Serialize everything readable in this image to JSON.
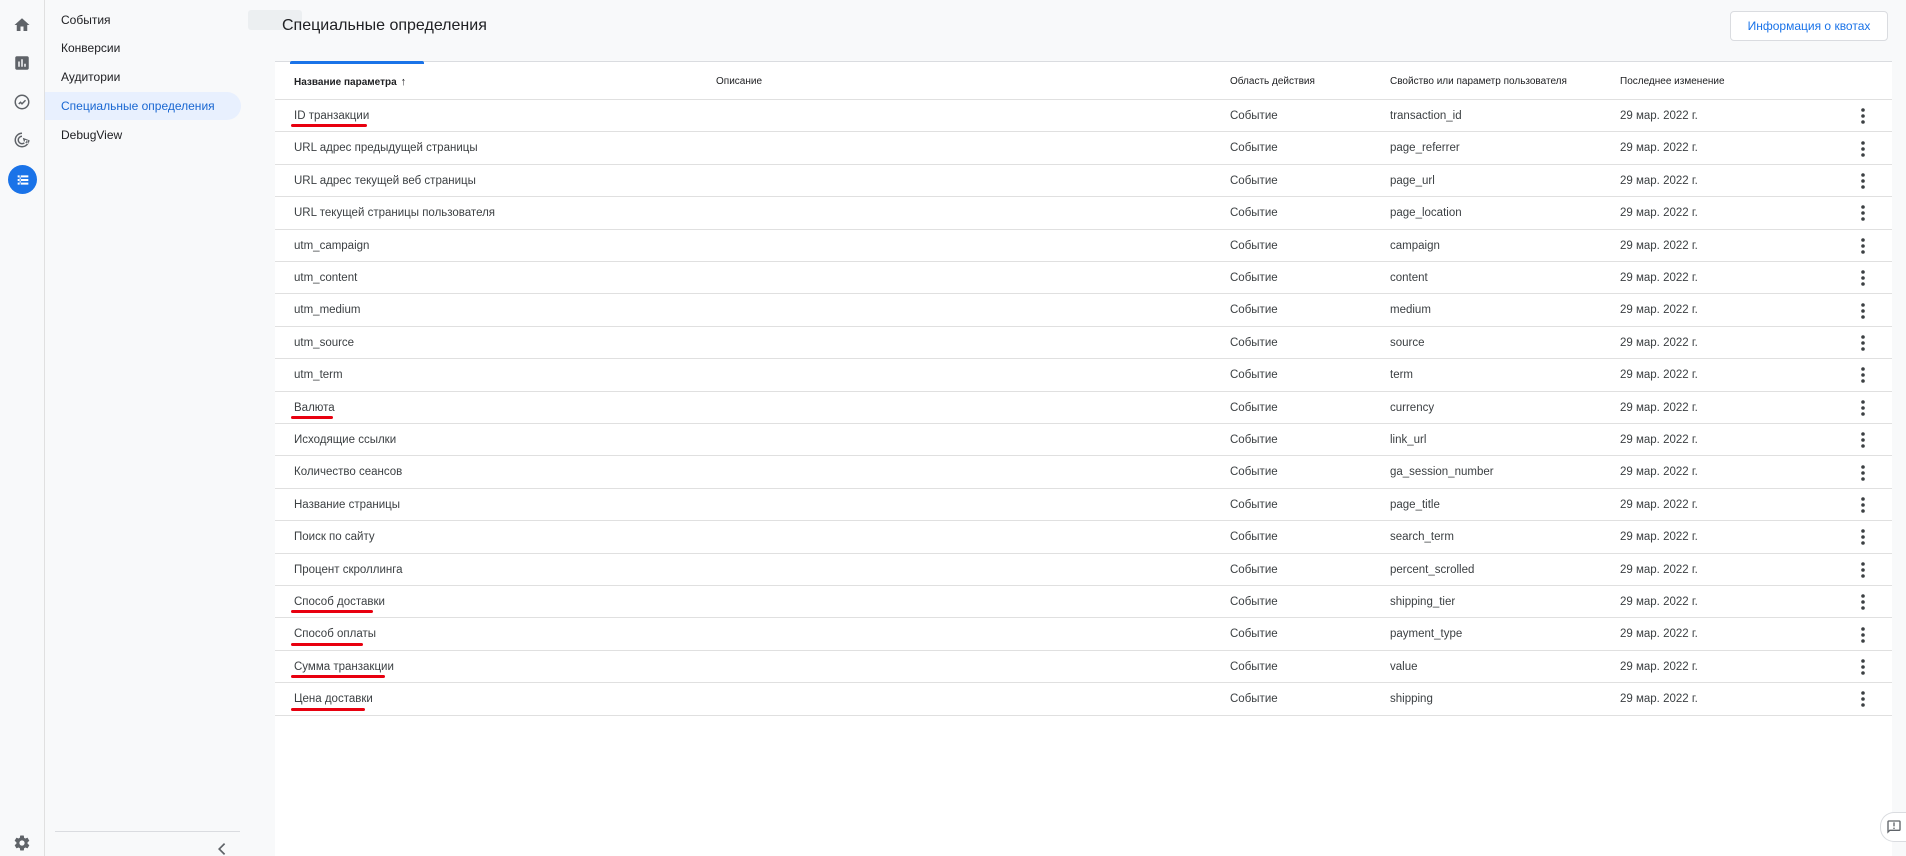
{
  "nav": {
    "items": [
      {
        "label": "События",
        "active": false
      },
      {
        "label": "Конверсии",
        "active": false
      },
      {
        "label": "Аудитории",
        "active": false
      },
      {
        "label": "Специальные определения",
        "active": true
      },
      {
        "label": "DebugView",
        "active": false
      }
    ]
  },
  "header": {
    "title": "Специальные определения",
    "quota_button": "Информация о квотах"
  },
  "table": {
    "columns": {
      "name": "Название параметра",
      "description": "Описание",
      "scope": "Область действия",
      "property": "Свойство или параметр пользователя",
      "modified": "Последнее изменение"
    },
    "sort_arrow": "↑",
    "rows": [
      {
        "name": "ID транзакции",
        "scope": "Событие",
        "property": "transaction_id",
        "modified": "29 мар. 2022 г.",
        "highlighted": true
      },
      {
        "name": "URL адрес предыдущей страницы",
        "scope": "Событие",
        "property": "page_referrer",
        "modified": "29 мар. 2022 г.",
        "highlighted": false
      },
      {
        "name": "URL адрес текущей веб страницы",
        "scope": "Событие",
        "property": "page_url",
        "modified": "29 мар. 2022 г.",
        "highlighted": false
      },
      {
        "name": "URL текущей страницы пользователя",
        "scope": "Событие",
        "property": "page_location",
        "modified": "29 мар. 2022 г.",
        "highlighted": false
      },
      {
        "name": "utm_campaign",
        "scope": "Событие",
        "property": "campaign",
        "modified": "29 мар. 2022 г.",
        "highlighted": false
      },
      {
        "name": "utm_content",
        "scope": "Событие",
        "property": "content",
        "modified": "29 мар. 2022 г.",
        "highlighted": false
      },
      {
        "name": "utm_medium",
        "scope": "Событие",
        "property": "medium",
        "modified": "29 мар. 2022 г.",
        "highlighted": false
      },
      {
        "name": "utm_source",
        "scope": "Событие",
        "property": "source",
        "modified": "29 мар. 2022 г.",
        "highlighted": false
      },
      {
        "name": "utm_term",
        "scope": "Событие",
        "property": "term",
        "modified": "29 мар. 2022 г.",
        "highlighted": false
      },
      {
        "name": "Валюта",
        "scope": "Событие",
        "property": "currency",
        "modified": "29 мар. 2022 г.",
        "highlighted": true
      },
      {
        "name": "Исходящие ссылки",
        "scope": "Событие",
        "property": "link_url",
        "modified": "29 мар. 2022 г.",
        "highlighted": false
      },
      {
        "name": "Количество сеансов",
        "scope": "Событие",
        "property": "ga_session_number",
        "modified": "29 мар. 2022 г.",
        "highlighted": false
      },
      {
        "name": "Название страницы",
        "scope": "Событие",
        "property": "page_title",
        "modified": "29 мар. 2022 г.",
        "highlighted": false
      },
      {
        "name": "Поиск по сайту",
        "scope": "Событие",
        "property": "search_term",
        "modified": "29 мар. 2022 г.",
        "highlighted": false
      },
      {
        "name": "Процент скроллинга",
        "scope": "Событие",
        "property": "percent_scrolled",
        "modified": "29 мар. 2022 г.",
        "highlighted": false
      },
      {
        "name": "Способ доставки",
        "scope": "Событие",
        "property": "shipping_tier",
        "modified": "29 мар. 2022 г.",
        "highlighted": true
      },
      {
        "name": "Способ оплаты",
        "scope": "Событие",
        "property": "payment_type",
        "modified": "29 мар. 2022 г.",
        "highlighted": true
      },
      {
        "name": "Сумма транзакции",
        "scope": "Событие",
        "property": "value",
        "modified": "29 мар. 2022 г.",
        "highlighted": true
      },
      {
        "name": "Цена доставки",
        "scope": "Событие",
        "property": "shipping",
        "modified": "29 мар. 2022 г.",
        "highlighted": true
      }
    ]
  },
  "colors": {
    "accent": "#1a73e8",
    "highlight_mark": "#e8000f",
    "nav_active_bg": "#e8f0fe"
  },
  "icons": {
    "rail": [
      "home-icon",
      "reports-icon",
      "explore-icon",
      "advertising-icon",
      "configure-icon"
    ],
    "settings": "gear-icon",
    "collapse": "chevron-left-icon",
    "row_menu": "more-vert-icon",
    "feedback": "feedback-icon"
  }
}
